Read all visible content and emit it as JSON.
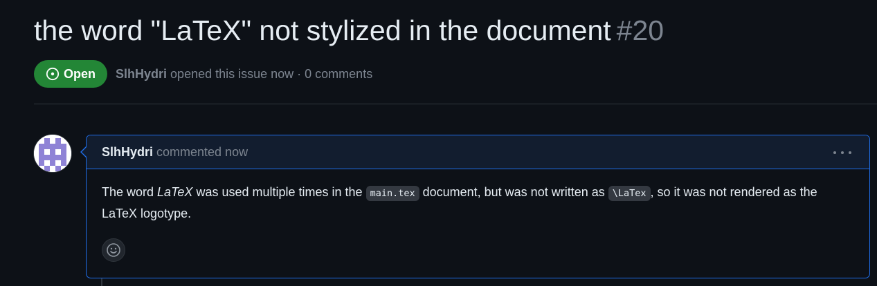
{
  "issue": {
    "title": "the word \"LaTeX\" not stylized in the document",
    "number": "#20",
    "state_label": "Open",
    "author": "SlhHydri",
    "opened_text": "opened this issue now · 0 comments"
  },
  "comment": {
    "author": "SlhHydri",
    "action": "commented now",
    "body": {
      "part1": "The word ",
      "emphasis": "LaTeX",
      "part2": " was used multiple times in the ",
      "code1": "main.tex",
      "part3": " document, but was not written as ",
      "code2": "\\LaTex",
      "part4": ", so it was not rendered as the LaTeX logotype."
    }
  },
  "icons": {
    "state": "issue-opened-icon",
    "menu": "kebab-horizontal-icon",
    "reaction": "smiley-icon",
    "avatar": "identicon"
  },
  "colors": {
    "background": "#0d1117",
    "open_badge": "#238636",
    "comment_border": "#1f6feb",
    "comment_header": "#121d2f",
    "muted_text": "#7d8590",
    "identicon": "#8f83d6"
  }
}
